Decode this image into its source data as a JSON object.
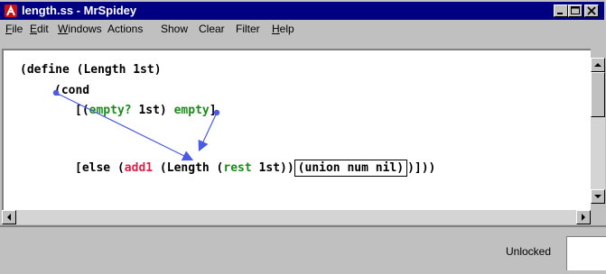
{
  "window": {
    "title": "length.ss - MrSpidey"
  },
  "menu": {
    "items": [
      {
        "underline": "F",
        "rest": "ile"
      },
      {
        "underline": "E",
        "rest": "dit"
      },
      {
        "underline": "W",
        "rest": "indows"
      },
      {
        "underline": "",
        "rest": "Actions"
      },
      {
        "underline": "",
        "rest": "Show"
      },
      {
        "underline": "",
        "rest": "Clear"
      },
      {
        "underline": "",
        "rest": "Filter"
      },
      {
        "underline": "H",
        "rest": "elp"
      }
    ]
  },
  "editor": {
    "line1": "(define (Length 1st)",
    "line2_open": "(",
    "line2_kw": "cond",
    "line3_open": "[(",
    "line3_empty_q": "empty?",
    "line3_arg": " 1st) ",
    "line3_empty": "empty",
    "line3_close": "]",
    "line4_else": "[else (",
    "line4_add1": "add1",
    "line4_length": " (Length (",
    "line4_rest": "rest",
    "line4_arg": " 1st))",
    "line4_type": "(union num nil)",
    "line4_close": ")]))",
    "arrow_color": "#4a5ae8"
  },
  "status": {
    "lock_label": "Unlocked"
  },
  "colors": {
    "titlebar": "#000080",
    "keyword_green": "#1a8c1a",
    "keyword_red": "#e0204a",
    "chrome": "#c0c0c0"
  }
}
